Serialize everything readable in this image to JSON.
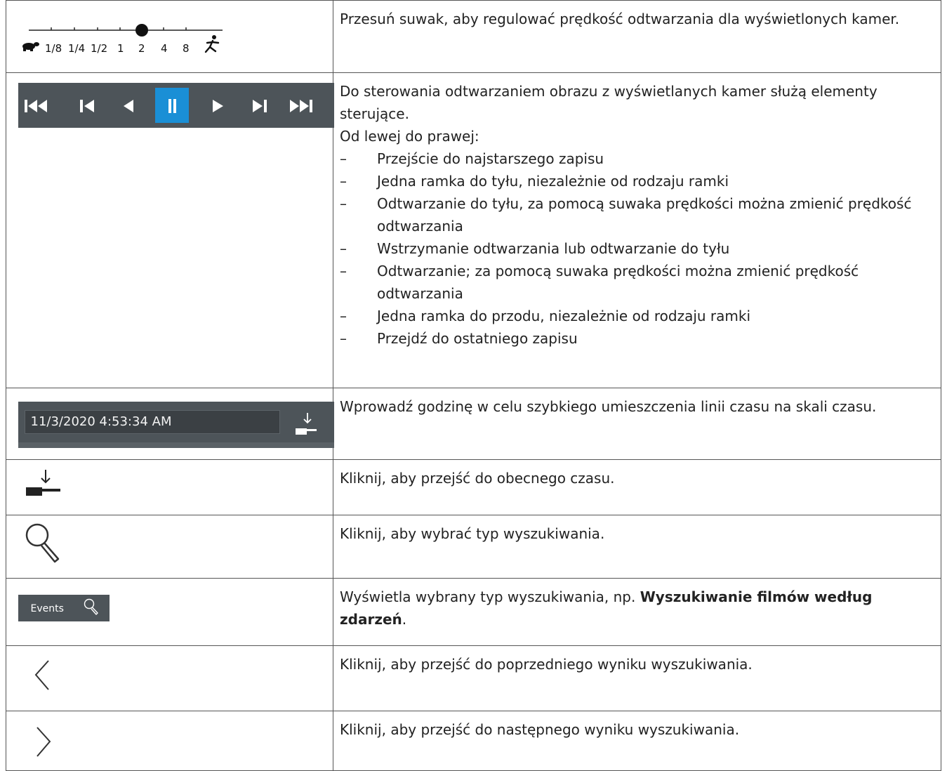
{
  "rows": [
    {
      "icon": "speed-slider",
      "speed_labels": [
        "1/8",
        "1/4",
        "1/2",
        "1",
        "2",
        "4",
        "8"
      ],
      "selected_speed": "2",
      "description": "Przesuń suwak, aby regulować prędkość odtwarzania dla wyświetlonych kamer."
    },
    {
      "icon": "playback-controls",
      "active_button": "pause",
      "description_lead": "Do sterowania odtwarzaniem obrazu z wyświetlanych kamer służą elementy sterujące.",
      "description_lead2": "Od lewej do prawej:",
      "bullets": [
        "Przejście do najstarszego zapisu",
        "Jedna ramka do tyłu, niezależnie od rodzaju ramki",
        "Odtwarzanie do tyłu, za pomocą suwaka prędkości można zmienić prędkość odtwarzania",
        "Wstrzymanie odtwarzania lub odtwarzanie do tyłu",
        "Odtwarzanie; za pomocą suwaka prędkości można zmienić prędkość odtwarzania",
        "Jedna ramka do przodu, niezależnie od rodzaju ramki",
        "Przejdź do ostatniego zapisu"
      ],
      "dash": "–"
    },
    {
      "icon": "time-input",
      "time_value": "11/3/2020 4:53:34 AM",
      "description": "Wprowadź godzinę w celu szybkiego umieszczenia linii czasu na skali czasu."
    },
    {
      "icon": "jump-to-now-icon",
      "description": "Kliknij, aby przejść do obecnego czasu."
    },
    {
      "icon": "search-icon",
      "description": "Kliknij, aby wybrać typ wyszukiwania."
    },
    {
      "icon": "events-search-button",
      "button_label": "Events",
      "description_pre": "Wyświetla wybrany typ wyszukiwania, np. ",
      "description_bold": "Wyszukiwanie filmów według zdarzeń",
      "description_post": "."
    },
    {
      "icon": "chevron-left-icon",
      "description": "Kliknij, aby przejść do poprzedniego wyniku wyszukiwania."
    },
    {
      "icon": "chevron-right-icon",
      "description": "Kliknij, aby przejść do następnego wyniku wyszukiwania."
    }
  ],
  "colors": {
    "border": "#555555",
    "toolbar_bg": "#4d5459",
    "active_button": "#1a8fd6",
    "icon_white": "#ffffff",
    "icon_dark": "#222222"
  }
}
